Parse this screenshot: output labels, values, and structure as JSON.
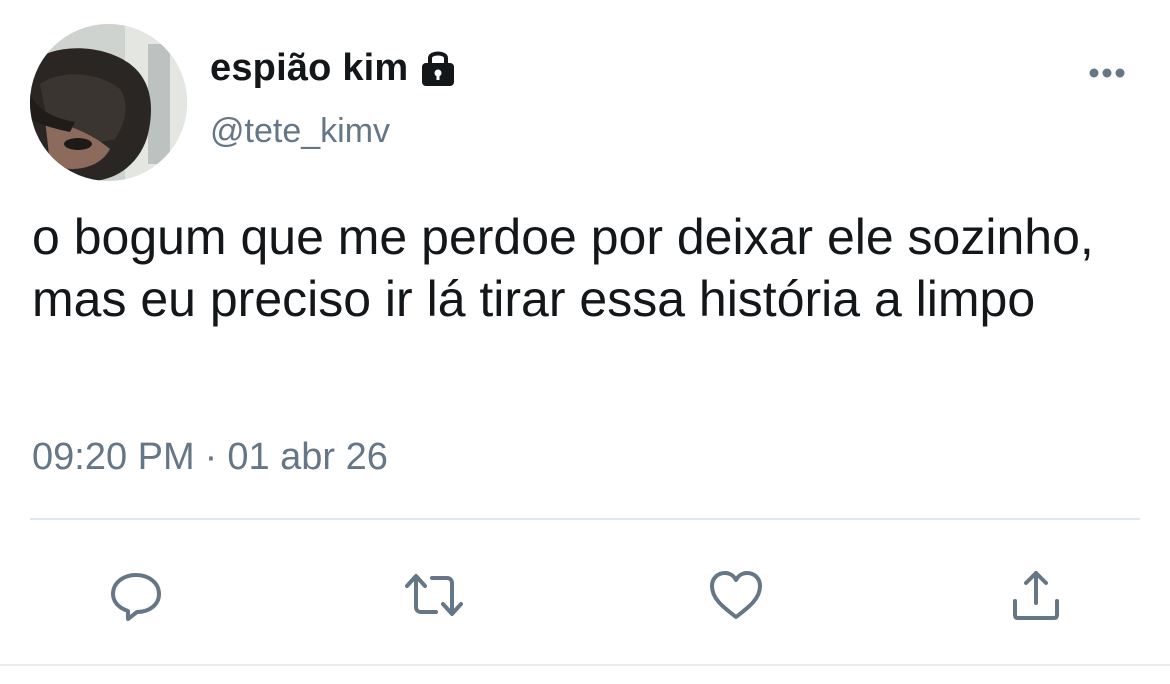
{
  "author": {
    "display_name": "espião kim",
    "handle": "@tete_kimv",
    "protected_icon": "lock-icon",
    "avatar": "profile-photo"
  },
  "tweet": {
    "text": "o bogum que me perdoe por deixar ele sozinho, mas eu preciso ir lá tirar essa história a limpo",
    "time": "09:20 PM",
    "separator": "·",
    "date": "01 abr 26"
  },
  "actions": [
    {
      "icon": "reply-icon"
    },
    {
      "icon": "retweet-icon"
    },
    {
      "icon": "like-icon"
    },
    {
      "icon": "share-icon"
    }
  ],
  "colors": {
    "text": "#14171a",
    "secondary": "#657786",
    "divider": "#e1e8ed"
  }
}
